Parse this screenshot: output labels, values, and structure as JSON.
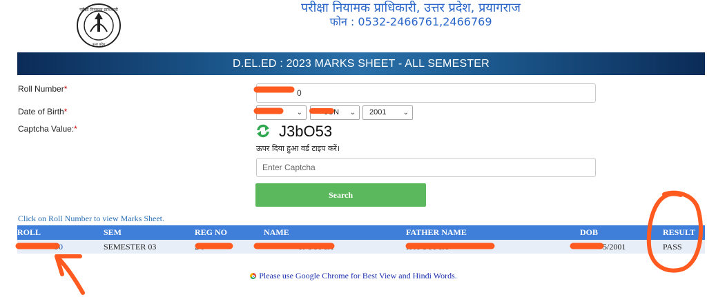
{
  "header": {
    "org_title": "परीक्षा नियामक प्राधिकारी, उत्तर प्रदेश, प्रयागराज",
    "org_phone": "फोन : 0532-2466761,2466769",
    "seal_text_top": "परीक्षा नियामक प्राधिकारी",
    "seal_text_bottom": "उत्तर प्रदेश"
  },
  "banner": {
    "title": "D.EL.ED : 2023 MARKS SHEET - ALL SEMESTER"
  },
  "form": {
    "roll_label": "Roll Number",
    "roll_value": "0",
    "dob_label": "Date of Birth",
    "dob_day": "",
    "dob_month": "-JUN",
    "dob_year": "2001",
    "captcha_label": "Captcha Value:",
    "required_mark": "*",
    "captcha_code": "J3bO53",
    "captcha_hint": "ऊपर दिया हुआ वर्ड टाइप करें।",
    "captcha_placeholder": "Enter Captcha",
    "search_label": "Search"
  },
  "results": {
    "hint": "Click on Roll Number to view Marks Sheet.",
    "columns": [
      "ROLL",
      "SEM",
      "REG NO",
      "NAME",
      "FATHER NAME",
      "DOB",
      "RESULT"
    ],
    "rows": [
      {
        "roll": "90",
        "sem": "SEMESTER 03",
        "reg_no": "2 9",
        "name": "R GUPTA",
        "father_name": "H A GUPTA",
        "dob": "5/2001",
        "result": "PASS"
      }
    ]
  },
  "footer": {
    "note": "Please use Google Chrome for Best View and Hindi Words."
  },
  "colors": {
    "banner_dark": "#0b2b57",
    "table_header": "#3f7ed9",
    "search_button": "#5cb85c",
    "annotation": "#ff5a1f"
  }
}
